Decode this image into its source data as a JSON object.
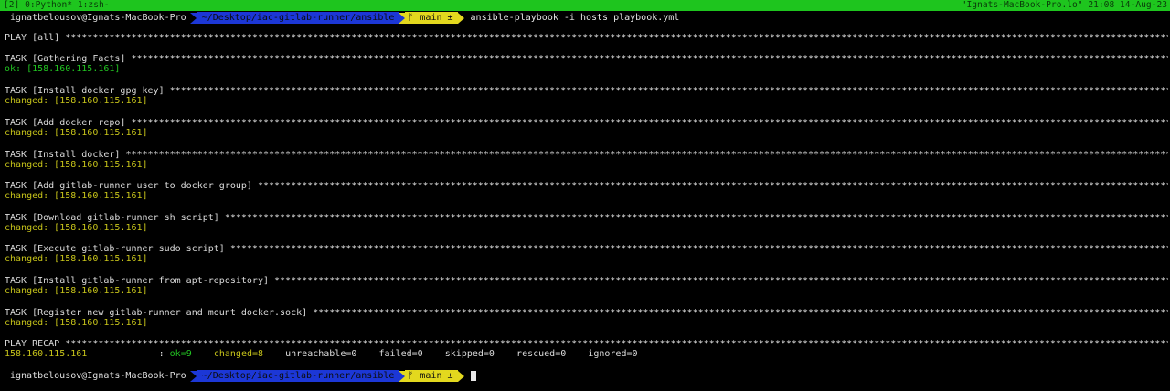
{
  "tmux": {
    "left": "[2] 0:Python* 1:zsh-",
    "right": "\"Ignats-MacBook-Pro.lo\" 21:08 14-Aug-23"
  },
  "prompt": {
    "user_host": "ignatbelousov@Ignats-MacBook-Pro",
    "path": "~/Desktop/iac-gitlab-runner/ansible",
    "git_icon": "ᚠ",
    "branch": "main ±",
    "command": "ansible-playbook -i hosts playbook.yml"
  },
  "output": {
    "play": "PLAY [all] ******************************************************************************************************************************************************************************************************************************",
    "tasks": [
      {
        "header": "TASK [Gathering Facts] *********************************************************************************************************************************************************************************************************",
        "result": "ok: [158.160.115.161]",
        "status": "ok"
      },
      {
        "header": "TASK [Install docker gpg key] **************************************************************************************************************************************************************************************************",
        "result": "changed: [158.160.115.161]",
        "status": "changed"
      },
      {
        "header": "TASK [Add docker repo] *********************************************************************************************************************************************************************************************************",
        "result": "changed: [158.160.115.161]",
        "status": "changed"
      },
      {
        "header": "TASK [Install docker] **********************************************************************************************************************************************************************************************************",
        "result": "changed: [158.160.115.161]",
        "status": "changed"
      },
      {
        "header": "TASK [Add gitlab-runner user to docker group] **************************************************************************************************************************************************************************",
        "result": "changed: [158.160.115.161]",
        "status": "changed"
      },
      {
        "header": "TASK [Download gitlab-runner sh script] ****************************************************************************************************************************************************************************",
        "result": "changed: [158.160.115.161]",
        "status": "changed"
      },
      {
        "header": "TASK [Execute gitlab-runner sudo script] ***************************************************************************************************************************************************************************",
        "result": "changed: [158.160.115.161]",
        "status": "changed"
      },
      {
        "header": "TASK [Install gitlab-runner from apt-repository] *******************************************************************************************************************************************************************",
        "result": "changed: [158.160.115.161]",
        "status": "changed"
      },
      {
        "header": "TASK [Register new gitlab-runner and mount docker.sock] ************************************************************************************************************************************************************",
        "result": "changed: [158.160.115.161]",
        "status": "changed"
      }
    ],
    "recap_header": "PLAY RECAP **********************************************************************************************************************************************************************************************************************",
    "recap": {
      "host": "158.160.115.161",
      "sep": ":",
      "ok": "ok=9",
      "changed": "changed=8",
      "unreachable": "unreachable=0",
      "failed": "failed=0",
      "skipped": "skipped=0",
      "rescued": "rescued=0",
      "ignored": "ignored=0"
    }
  },
  "colors": {
    "tmux_bar": "#1ec51e",
    "path_segment": "#1c37d6",
    "git_segment": "#e3d81e",
    "ok": "#22c422",
    "changed": "#c7c41a"
  }
}
